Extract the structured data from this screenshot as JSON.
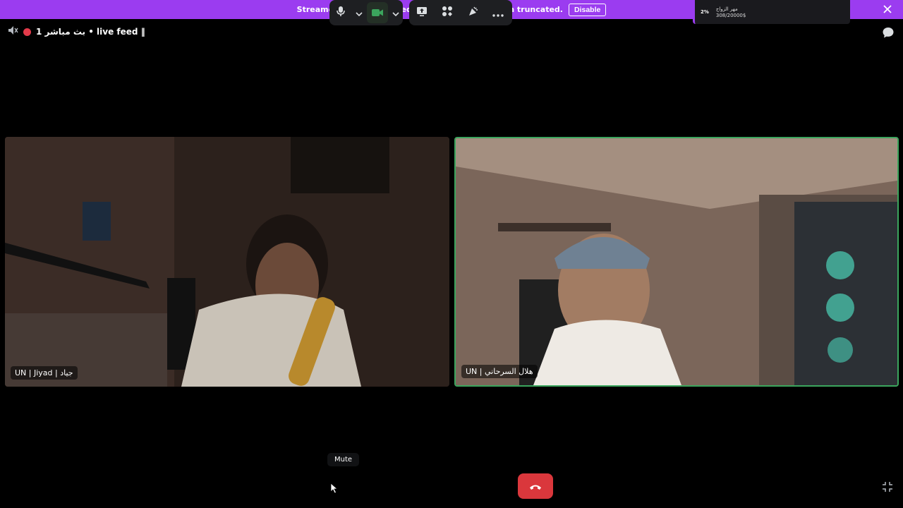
{
  "banner": {
    "text": "Streamer Mode is enabled. Usernames have been truncated.",
    "button_label": "Disable"
  },
  "donation": {
    "percent": "2%",
    "title": "مهر الزواج",
    "amount": "308/20000$"
  },
  "header": {
    "channel_name": "بث مباشر 1 • live feed ‖"
  },
  "tiles": [
    {
      "name": "UN | Jiyad | جياد",
      "speaking": false
    },
    {
      "name": "UN | هلال السرحاني",
      "speaking": true
    }
  ],
  "controls": {
    "tooltip": "Mute"
  },
  "colors": {
    "banner": "#9b3cf0",
    "speaking_border": "#3ba55d",
    "end_call": "#da373c",
    "live": "#e23a4a"
  }
}
